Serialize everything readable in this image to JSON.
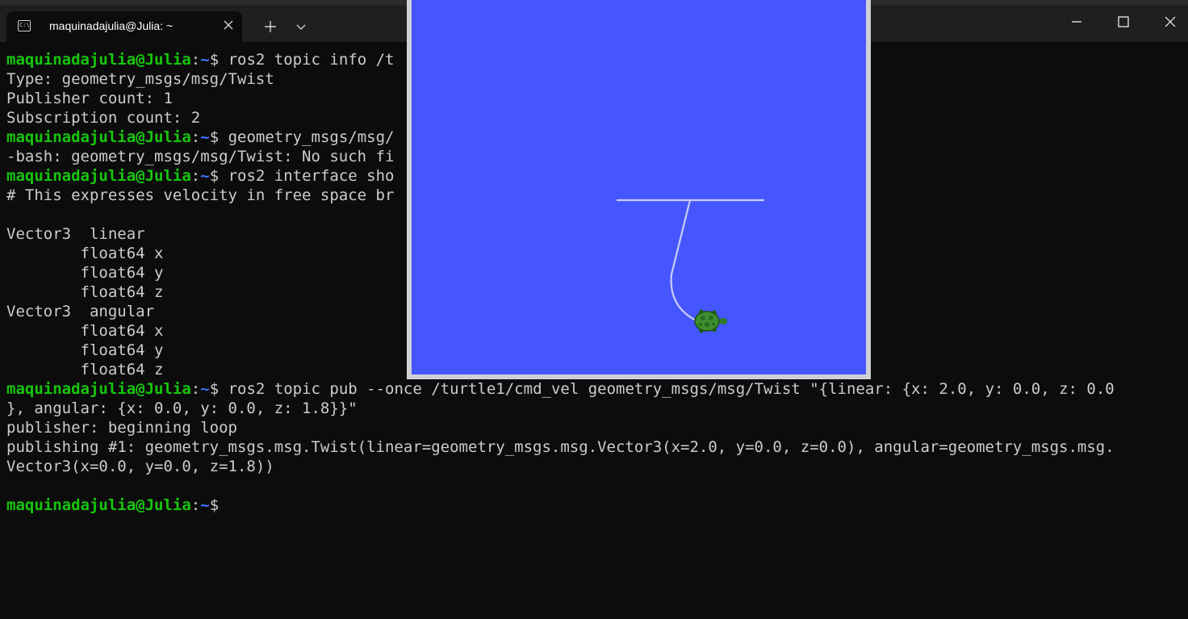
{
  "window": {
    "tab_title": "maquinadajulia@Julia: ~",
    "tab_icon": "terminal-icon",
    "buttons": [
      "new-tab",
      "dropdown",
      "minimize",
      "maximize",
      "close"
    ]
  },
  "prompt": {
    "user_host": "maquinadajulia@Julia",
    "path": "~",
    "sign": "$ "
  },
  "terminal": {
    "lines": [
      {
        "prompt": true,
        "text": "ros2 topic info /t"
      },
      {
        "prompt": false,
        "text": "Type: geometry_msgs/msg/Twist"
      },
      {
        "prompt": false,
        "text": "Publisher count: 1"
      },
      {
        "prompt": false,
        "text": "Subscription count: 2"
      },
      {
        "prompt": true,
        "text": "geometry_msgs/msg/"
      },
      {
        "prompt": false,
        "text": "-bash: geometry_msgs/msg/Twist: No such fi"
      },
      {
        "prompt": true,
        "text": "ros2 interface sho"
      },
      {
        "prompt": false,
        "text": "# This expresses velocity in free space br"
      },
      {
        "prompt": false,
        "text": ""
      },
      {
        "prompt": false,
        "text": "Vector3  linear"
      },
      {
        "prompt": false,
        "text": "        float64 x"
      },
      {
        "prompt": false,
        "text": "        float64 y"
      },
      {
        "prompt": false,
        "text": "        float64 z"
      },
      {
        "prompt": false,
        "text": "Vector3  angular"
      },
      {
        "prompt": false,
        "text": "        float64 x"
      },
      {
        "prompt": false,
        "text": "        float64 y"
      },
      {
        "prompt": false,
        "text": "        float64 z"
      },
      {
        "prompt": true,
        "text": "ros2 topic pub --once /turtle1/cmd_vel geometry_msgs/msg/Twist \"{linear: {x: 2.0, y: 0.0, z: 0.0"
      },
      {
        "prompt": false,
        "text": "}, angular: {x: 0.0, y: 0.0, z: 1.8}}\""
      },
      {
        "prompt": false,
        "text": "publisher: beginning loop"
      },
      {
        "prompt": false,
        "text": "publishing #1: geometry_msgs.msg.Twist(linear=geometry_msgs.msg.Vector3(x=2.0, y=0.0, z=0.0), angular=geometry_msgs.msg."
      },
      {
        "prompt": false,
        "text": "Vector3(x=0.0, y=0.0, z=1.8))"
      },
      {
        "prompt": false,
        "text": ""
      },
      {
        "prompt": true,
        "text": ""
      }
    ]
  },
  "turtlesim": {
    "background_color": "#4556ff",
    "trail_color": "#c8cbf5",
    "turtle_icon": "turtle-icon"
  },
  "colors": {
    "terminal_bg": "#0c0c0c",
    "text": "#cccccc",
    "prompt_user": "#16c60c",
    "prompt_path": "#3b78ff",
    "titlebar": "#1f1f1f"
  }
}
